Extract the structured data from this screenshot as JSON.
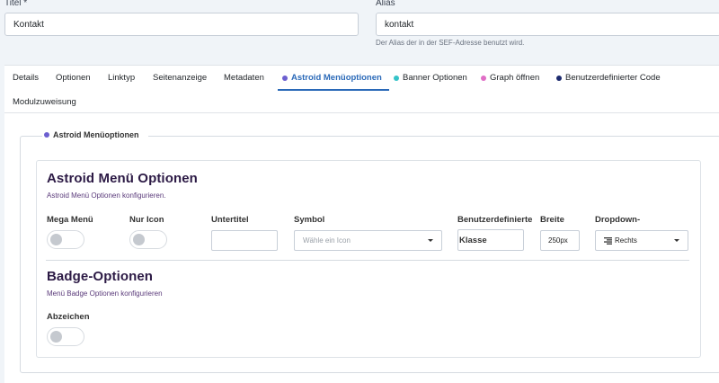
{
  "header": {
    "title_label": "Titel *",
    "title_value": "Kontakt",
    "alias_label": "Alias",
    "alias_value": "kontakt",
    "alias_help": "Der Alias der in der SEF-Adresse benutzt wird."
  },
  "tabs": [
    {
      "label": "Details"
    },
    {
      "label": "Optionen"
    },
    {
      "label": "Linktyp"
    },
    {
      "label": "Seitenanzeige"
    },
    {
      "label": "Metadaten"
    },
    {
      "label": "Astroid Menüoptionen",
      "active": true,
      "dot": "#6c5fd0"
    },
    {
      "label": "Banner Optionen",
      "dot": "#35c3c8"
    },
    {
      "label": "Graph öffnen",
      "dot": "#e06ec6"
    },
    {
      "label": "Benutzerdefinierter Code",
      "dot": "#1c2a6e"
    },
    {
      "label": "Modulzuweisung"
    }
  ],
  "fieldset": {
    "legend": "Astroid Menüoptionen",
    "legend_dot": "#6c5fd0"
  },
  "menu_options": {
    "heading": "Astroid Menü Optionen",
    "description": "Astroid Menü Optionen konfigurieren.",
    "mega_menu_label": "Mega Menü",
    "mega_menu_on": false,
    "icon_only_label": "Nur Icon",
    "icon_only_on": false,
    "subtitle_label": "Untertitel",
    "subtitle_value": "",
    "symbol_label": "Symbol",
    "symbol_placeholder": "Wähle ein Icon",
    "custom_class_label": "Benutzerdefinierte",
    "custom_class_value": "Klasse",
    "width_label": "Breite",
    "width_value": "250px",
    "dropdown_label": "Dropdown-",
    "dropdown_value": "Rechts",
    "dropdown_icon": "align-right-icon"
  },
  "badge_options": {
    "heading": "Badge-Optionen",
    "description": "Menü Badge Optionen konfigurieren",
    "badge_label": "Abzeichen",
    "badge_on": false
  },
  "colors": {
    "accent": "#2a69b8",
    "heading": "#2c1a45"
  }
}
